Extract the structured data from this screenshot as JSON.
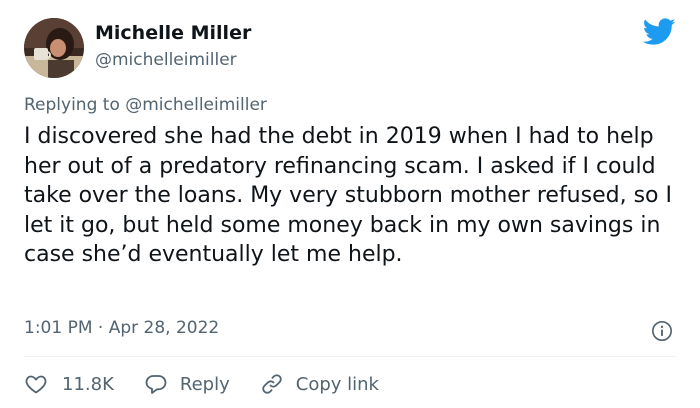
{
  "author": {
    "name": "Michelle Miller",
    "handle": "@michelleimiller"
  },
  "reply": {
    "prefix": "Replying to ",
    "mention": "@michelleimiller"
  },
  "tweet": {
    "text": "I discovered she had the debt in 2019 when I had to help her out of a predatory refinancing scam. I asked if I could take over the loans. My very stubborn mother refused, so I let it go, but held some money back in my own savings in case she’d eventually let me help.",
    "timestamp": "1:01 PM · Apr 28, 2022"
  },
  "actions": {
    "likes": "11.8K",
    "reply": "Reply",
    "copy_link": "Copy link"
  },
  "icons": {
    "logo": "twitter-bird-icon",
    "info": "info-icon",
    "like": "heart-icon",
    "reply": "reply-bubble-icon",
    "link": "link-icon"
  },
  "colors": {
    "brand": "#1d9bf0",
    "text": "#0f1419",
    "secondary": "#536471"
  }
}
